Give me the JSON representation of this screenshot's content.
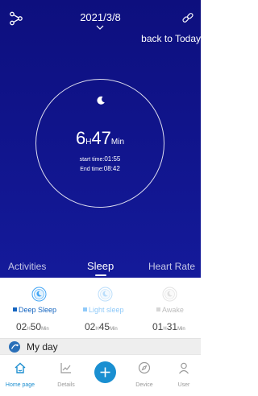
{
  "header": {
    "date": "2021/3/8",
    "back_to_today": "back to Today"
  },
  "sleep_summary": {
    "hours": "6",
    "hours_unit": "H",
    "minutes": "47",
    "minutes_unit": "Min",
    "start_label": "start time:",
    "start_value": "01:55",
    "end_label": "End time:",
    "end_value": "08:42"
  },
  "tabs": [
    {
      "label": "Activities",
      "active": false
    },
    {
      "label": "Sleep",
      "active": true
    },
    {
      "label": "Heart Rate",
      "active": false
    }
  ],
  "stages": [
    {
      "label": "Deep Sleep",
      "hours": "02",
      "h_unit": "H",
      "minutes": "50",
      "m_unit": "Min",
      "color": "#1565c0",
      "icon": "deep-sleep-icon"
    },
    {
      "label": "Light sleep",
      "hours": "02",
      "h_unit": "H",
      "minutes": "45",
      "m_unit": "Min",
      "color": "#90caf9",
      "icon": "light-sleep-icon"
    },
    {
      "label": "Awake",
      "hours": "01",
      "h_unit": "H",
      "minutes": "31",
      "m_unit": "Min",
      "color": "#d6d6d6",
      "icon": "awake-icon"
    }
  ],
  "my_day": {
    "label": "My day"
  },
  "bottom_nav": [
    {
      "label": "Home page",
      "icon": "home-icon",
      "active": true
    },
    {
      "label": "Details",
      "icon": "chart-icon",
      "active": false
    },
    {
      "label": "",
      "icon": "plus-icon",
      "active": false
    },
    {
      "label": "Device",
      "icon": "compass-icon",
      "active": false
    },
    {
      "label": "User",
      "icon": "user-icon",
      "active": false
    }
  ],
  "colors": {
    "hero_background": "#0d0f7e",
    "accent": "#1a8fd1"
  }
}
